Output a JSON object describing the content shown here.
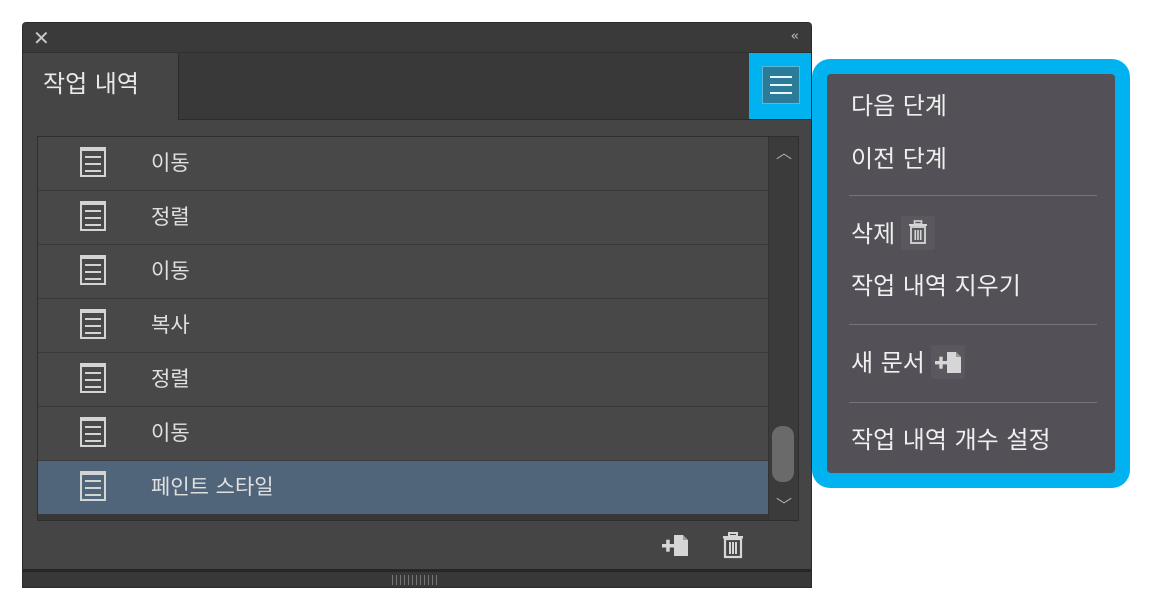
{
  "panel": {
    "tab_label": "작업 내역",
    "close_glyph": "✕",
    "collapse_glyph": "‹‹"
  },
  "history": {
    "items": [
      {
        "label": "이동",
        "icon": "document-icon",
        "selected": false
      },
      {
        "label": "정렬",
        "icon": "document-icon",
        "selected": false
      },
      {
        "label": "이동",
        "icon": "document-icon",
        "selected": false
      },
      {
        "label": "복사",
        "icon": "document-icon",
        "selected": false
      },
      {
        "label": "정렬",
        "icon": "document-icon",
        "selected": false
      },
      {
        "label": "이동",
        "icon": "document-icon",
        "selected": false
      },
      {
        "label": "페인트 스타일",
        "icon": "document-icon",
        "selected": true
      }
    ]
  },
  "scroll": {
    "up_glyph": "︿",
    "down_glyph": "﹀"
  },
  "flyout_menu": {
    "items": [
      {
        "label": "다음 단계"
      },
      {
        "label": "이전 단계"
      },
      {
        "label": "삭제",
        "icon": "trash-icon"
      },
      {
        "label": "작업 내역 지우기"
      },
      {
        "label": "새 문서",
        "icon": "new-document-icon"
      },
      {
        "label": "작업 내역 개수 설정"
      }
    ]
  },
  "colors": {
    "highlight": "#00b2ef",
    "panel_bg": "#454545",
    "selected_row": "#51657a",
    "menu_bg": "#535157"
  }
}
